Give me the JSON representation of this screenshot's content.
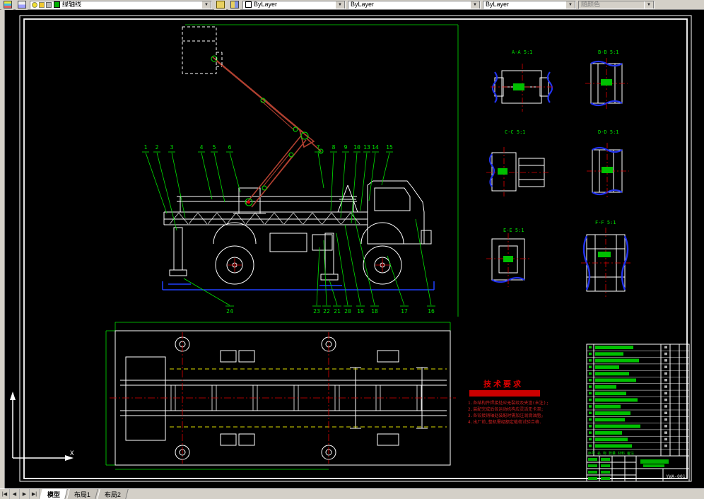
{
  "toolbar": {
    "layer_combo": {
      "value": "绿轴线"
    },
    "color_combo": {
      "value": "ByLayer"
    },
    "linetype_combo": {
      "value": "ByLayer"
    },
    "lineweight_combo": {
      "value": "ByLayer"
    },
    "plotstyle_combo": {
      "value": "随颜色"
    }
  },
  "tabs": {
    "model": "模型",
    "layout1": "布局1",
    "layout2": "布局2"
  },
  "drawing": {
    "callouts_top": [
      "1",
      "2",
      "3",
      "4",
      "5",
      "6",
      "7",
      "8",
      "9",
      "10",
      "13",
      "14",
      "15"
    ],
    "callouts_bottom": [
      "24",
      "23",
      "22",
      "21",
      "20",
      "19",
      "18",
      "17",
      "16"
    ],
    "sections": [
      {
        "label": "A-A  5:1"
      },
      {
        "label": "B-B  5:1"
      },
      {
        "label": "C-C  5:1"
      },
      {
        "label": "D-D  5:1"
      },
      {
        "label": "E-E  5:1"
      },
      {
        "label": "F-F  5:1"
      }
    ],
    "tech": {
      "title": "技术要求",
      "lines": [
        "1.各结构件焊接处应无裂纹及夹渣(未注);",
        "2.装配完成后各运动机构应灵活无卡滞;",
        "3.各铰接销轴处装配时需加注润滑油脂;",
        "4.出厂前,整机需经额定载荷试验合格."
      ]
    },
    "bom": {
      "header": "序号  名 称  数量  材料  备注"
    },
    "title_block": {
      "drawing_no": "YWA-001"
    },
    "ucs": {
      "x_label": "X"
    }
  }
}
